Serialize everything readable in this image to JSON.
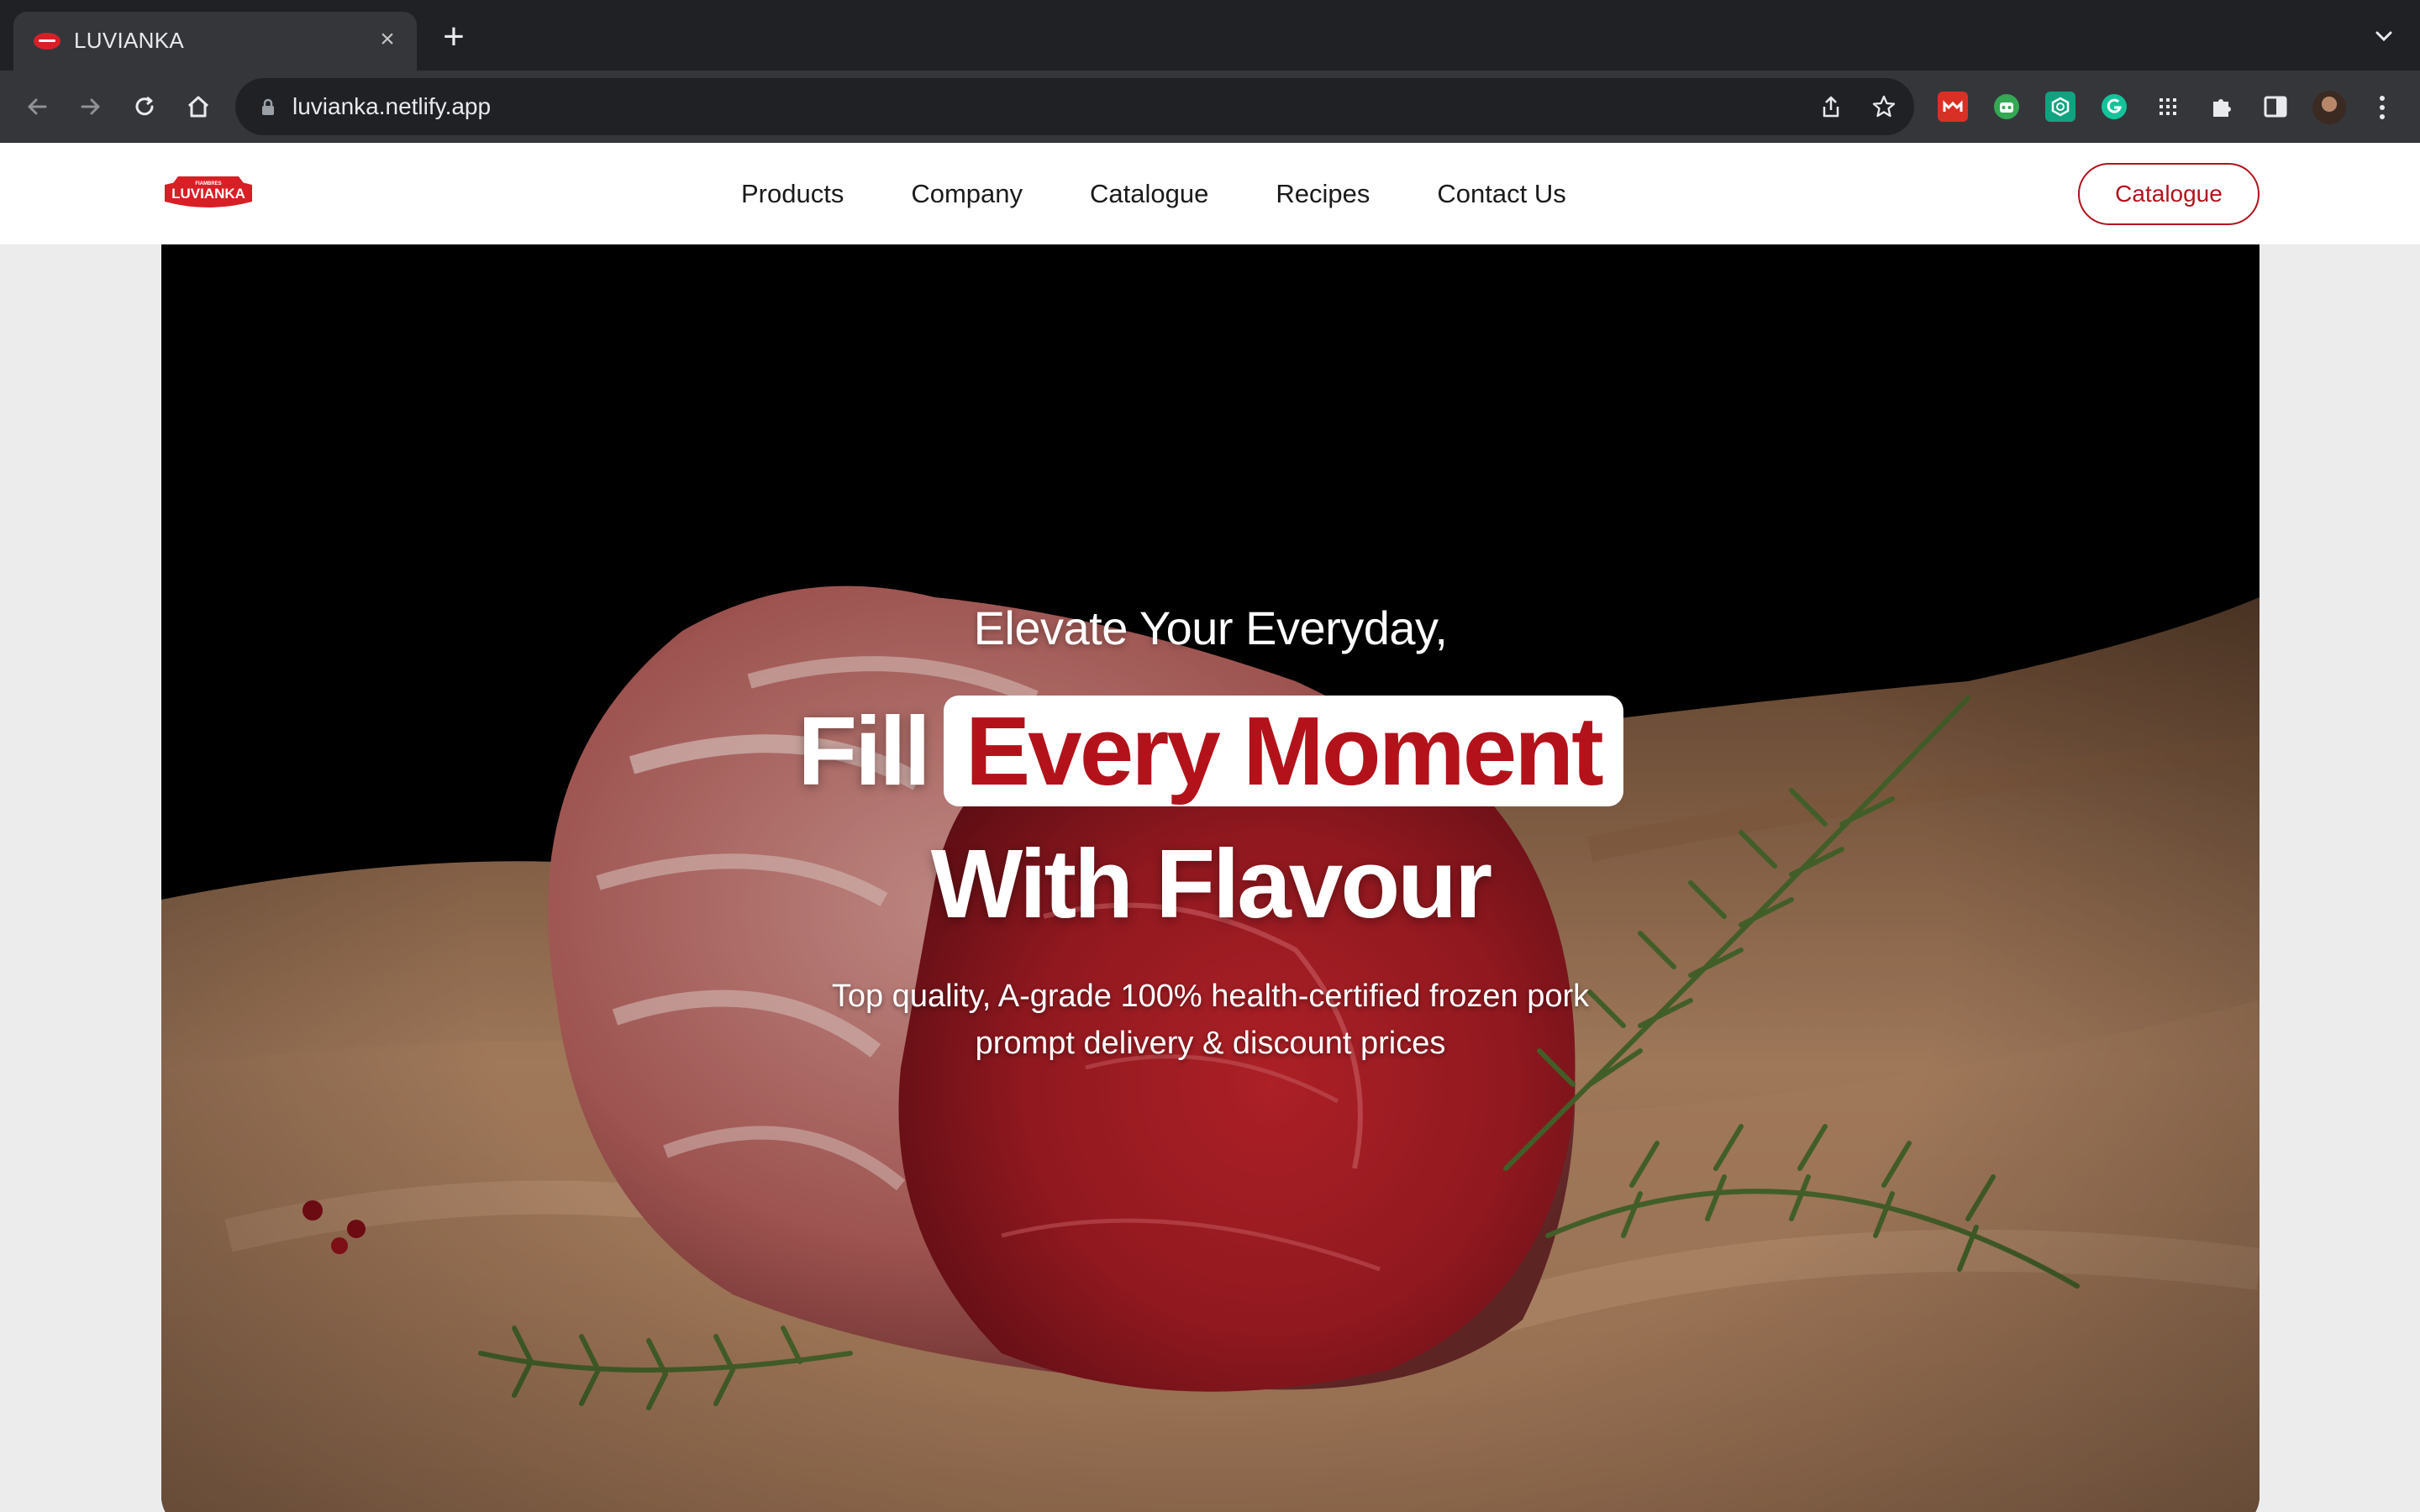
{
  "browser": {
    "tab_title": "LUVIANKA",
    "url": "luvianka.netlify.app",
    "accent": "#d91f26"
  },
  "site": {
    "logo_text": "LUVIANKA",
    "logo_small_text": "FIAMBRES",
    "nav": [
      "Products",
      "Company",
      "Catalogue",
      "Recipes",
      "Contact Us"
    ],
    "cta_label": "Catalogue",
    "brand_color": "#b3121b"
  },
  "hero": {
    "eyebrow": "Elevate Your Everyday,",
    "headline_prefix": "Fill",
    "headline_highlight": "Every Moment",
    "headline_line2": "With Flavour",
    "subtitle_line1": "Top quality, A-grade 100% health-certified frozen pork",
    "subtitle_line2": "prompt delivery & discount prices",
    "image": "raw pork loin on brown parchment paper with rosemary sprigs"
  }
}
